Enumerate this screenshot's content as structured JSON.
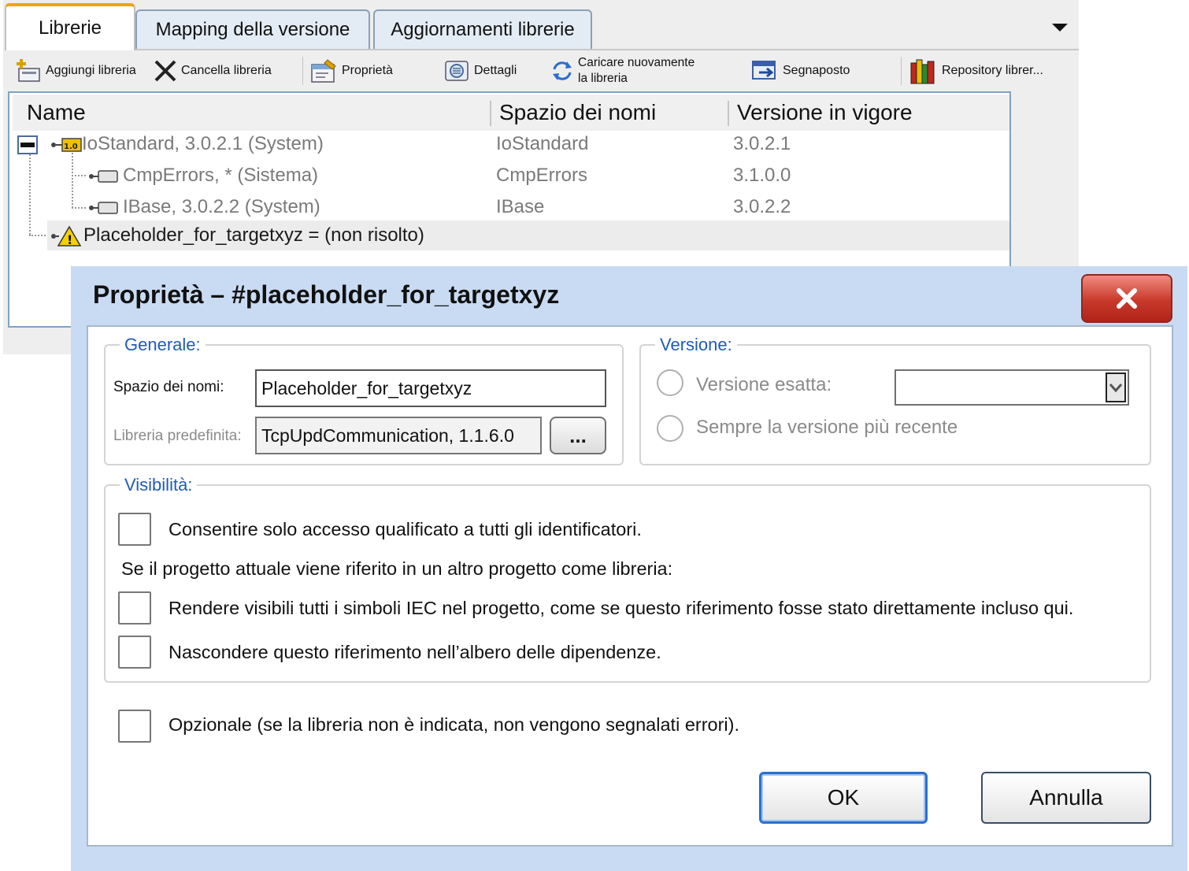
{
  "tabs": [
    {
      "label": "Librerie",
      "active": true
    },
    {
      "label": "Mapping della versione",
      "active": false
    },
    {
      "label": "Aggiornamenti librerie",
      "active": false
    }
  ],
  "toolbar": {
    "add_library": "Aggiungi libreria",
    "delete_library": "Cancella libreria",
    "properties": "Proprietà",
    "details": "Dettagli",
    "reload_line1": "Caricare nuovamente",
    "reload_line2": "la libreria",
    "placeholder": "Segnaposto",
    "repository": "Repository librer..."
  },
  "tree": {
    "columns": [
      "Name",
      "Spazio dei nomi",
      "Versione in vigore"
    ],
    "rows": [
      {
        "name": "IoStandard, 3.0.2.1 (System)",
        "namespace": "IoStandard",
        "version": "3.0.2.1",
        "dim": true
      },
      {
        "name": "CmpErrors, * (Sistema)",
        "namespace": "CmpErrors",
        "version": "3.1.0.0",
        "dim": true
      },
      {
        "name": "IBase, 3.0.2.2 (System)",
        "namespace": "IBase",
        "version": "3.0.2.2",
        "dim": true
      },
      {
        "name": "Placeholder_for_targetxyz = (non risolto)",
        "namespace": "",
        "version": "",
        "dim": false
      }
    ]
  },
  "dialog": {
    "title": "Proprietà – #placeholder_for_targetxyz",
    "general": {
      "legend": "Generale:",
      "namespace_label": "Spazio dei nomi:",
      "namespace_value": "Placeholder_for_targetxyz",
      "default_library_label": "Libreria predefinita:",
      "default_library_value": "TcpUpdCommunication, 1.1.6.0",
      "browse_label": "..."
    },
    "version": {
      "legend": "Versione:",
      "exact_label": "Versione esatta:",
      "exact_value": "",
      "latest_label": "Sempre la versione più recente"
    },
    "visibility": {
      "legend": "Visibilità:",
      "qualified_access": "Consentire solo accesso qualificato a tutti gli identificatori.",
      "referenced_note": "Se il progetto attuale viene riferito in un altro progetto come libreria:",
      "make_visible": "Rendere visibili tutti i simboli IEC nel progetto, come se questo riferimento fosse stato direttamente incluso qui.",
      "hide_reference": "Nascondere questo riferimento nell’albero delle dipendenze."
    },
    "optional": "Opzionale (se la libreria non è indicata, non vengono segnalati errori).",
    "ok_label": "OK",
    "cancel_label": "Annulla"
  },
  "colors": {
    "active_tab_accent": "#f0a500",
    "legend_blue": "#1f5bb8",
    "dialog_frame": "#c9dbf2",
    "close_button_red": "#c8392b"
  }
}
